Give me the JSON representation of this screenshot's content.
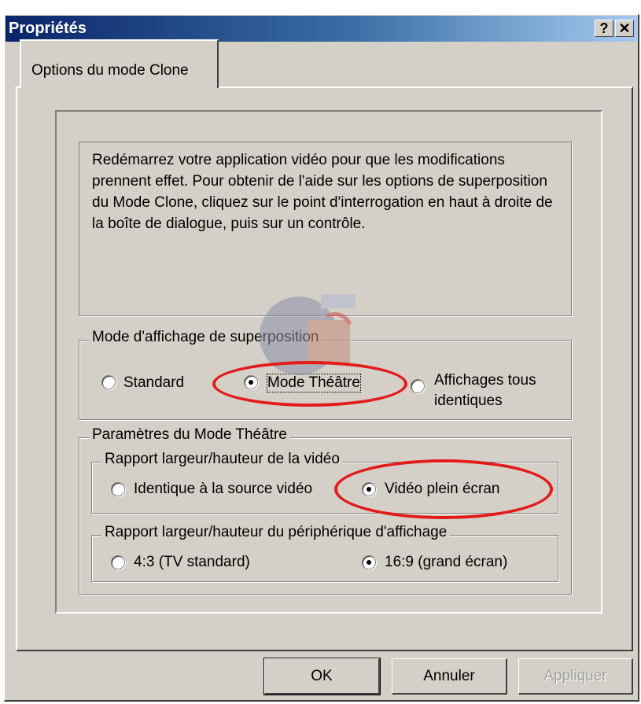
{
  "window": {
    "title": "Propriétés",
    "help_button": "?",
    "close_button": "✕"
  },
  "tabs": [
    {
      "label": "Options du mode Clone",
      "selected": true
    }
  ],
  "info_text": "Redémarrez votre application vidéo pour que les modifications prennent effet. Pour obtenir de l'aide sur les options de superposition du Mode Clone, cliquez sur le point d'interrogation en haut à droite de la boîte de dialogue, puis sur un contrôle.",
  "overlay_mode": {
    "legend": "Mode d'affichage de superposition",
    "options": [
      {
        "label": "Standard",
        "checked": false
      },
      {
        "label": "Mode Théâtre",
        "checked": true
      },
      {
        "label_line1": "Affichages tous",
        "label_line2": "identiques",
        "checked": false
      }
    ]
  },
  "theater_settings": {
    "legend": "Paramètres du Mode Théâtre",
    "video_aspect": {
      "legend": "Rapport largeur/hauteur de la vidéo",
      "options": [
        {
          "label": "Identique à la source vidéo",
          "checked": false
        },
        {
          "label": "Vidéo plein écran",
          "checked": true
        }
      ]
    },
    "display_aspect": {
      "legend": "Rapport largeur/hauteur du périphérique d'affichage",
      "options": [
        {
          "label": "4:3 (TV standard)",
          "checked": false
        },
        {
          "label": "16:9 (grand écran)",
          "checked": true
        }
      ]
    }
  },
  "buttons": {
    "ok": "OK",
    "cancel": "Annuler",
    "apply": "Appliquer",
    "apply_enabled": false
  },
  "colors": {
    "highlight_ellipse": "#e21b1b",
    "title_bar_start": "#0a246a",
    "title_bar_end": "#a6caf0"
  }
}
